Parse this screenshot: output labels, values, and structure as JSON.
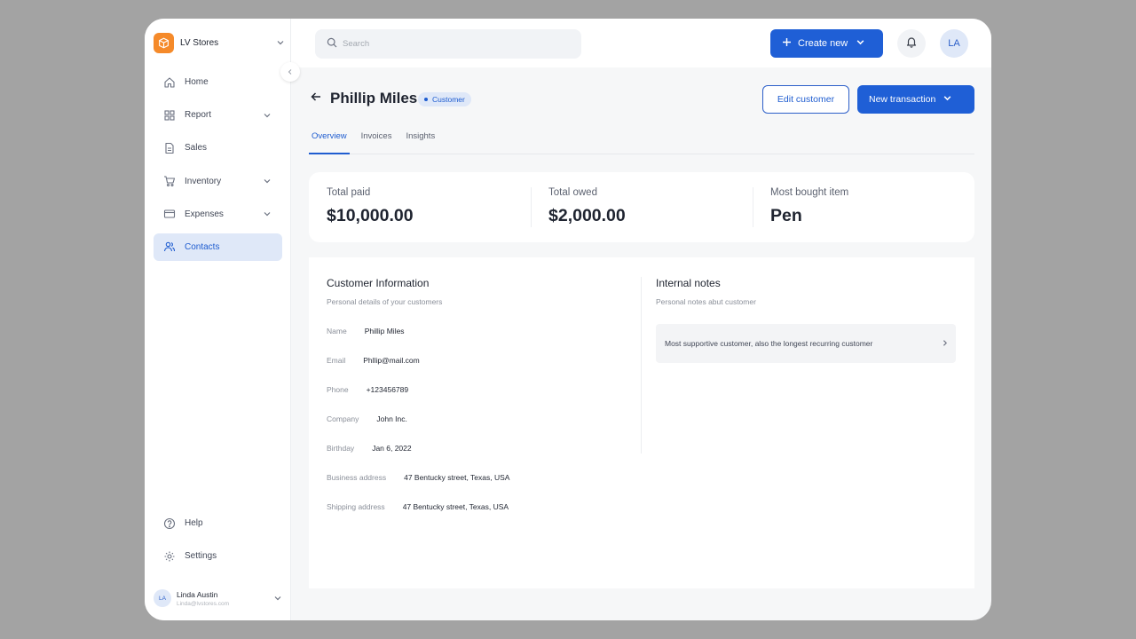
{
  "store": {
    "name": "LV Stores"
  },
  "sidebar": {
    "items": [
      {
        "label": "Home"
      },
      {
        "label": "Report"
      },
      {
        "label": "Sales"
      },
      {
        "label": "Inventory"
      },
      {
        "label": "Expenses"
      },
      {
        "label": "Contacts"
      }
    ],
    "bottom": [
      {
        "label": "Help"
      },
      {
        "label": "Settings"
      }
    ],
    "user": {
      "initials": "LA",
      "name": "Linda Austin",
      "email": "Linda@lvstores.com"
    }
  },
  "topbar": {
    "search_placeholder": "Search",
    "create_label": "Create new",
    "avatar_initials": "LA"
  },
  "page": {
    "title": "Phillip Miles",
    "badge": "Customer",
    "edit_label": "Edit customer",
    "transaction_label": "New transaction",
    "tabs": [
      {
        "label": "Overview"
      },
      {
        "label": "Invoices"
      },
      {
        "label": "Insights"
      }
    ]
  },
  "stats": [
    {
      "label": "Total paid",
      "value": "$10,000.00"
    },
    {
      "label": "Total owed",
      "value": "$2,000.00"
    },
    {
      "label": "Most bought item",
      "value": "Pen"
    }
  ],
  "customer_info": {
    "title": "Customer Information",
    "subtitle": "Personal details of your customers",
    "fields": [
      {
        "key": "Name",
        "value": "Phillip Miles"
      },
      {
        "key": "Email",
        "value": "Phllip@mail.com"
      },
      {
        "key": "Phone",
        "value": "+123456789"
      },
      {
        "key": "Company",
        "value": "John Inc."
      },
      {
        "key": "Birthday",
        "value": "Jan 6, 2022"
      },
      {
        "key": "Business address",
        "value": "47 Bentucky street, Texas, USA"
      },
      {
        "key": "Shipping address",
        "value": "47 Bentucky street, Texas, USA"
      }
    ]
  },
  "internal_notes": {
    "title": "Internal notes",
    "subtitle": "Personal notes abut customer",
    "note": "Most supportive customer, also the longest recurring customer"
  },
  "colors": {
    "accent": "#1f5fd6",
    "brand": "#f58a2a",
    "active_bg": "#dfe8f8"
  },
  "icons": {
    "store_logo": "box-icon",
    "nav": [
      "home-icon",
      "grid-icon",
      "document-icon",
      "cart-icon",
      "card-icon",
      "users-icon"
    ],
    "bottom": [
      "help-icon",
      "gear-icon"
    ]
  }
}
